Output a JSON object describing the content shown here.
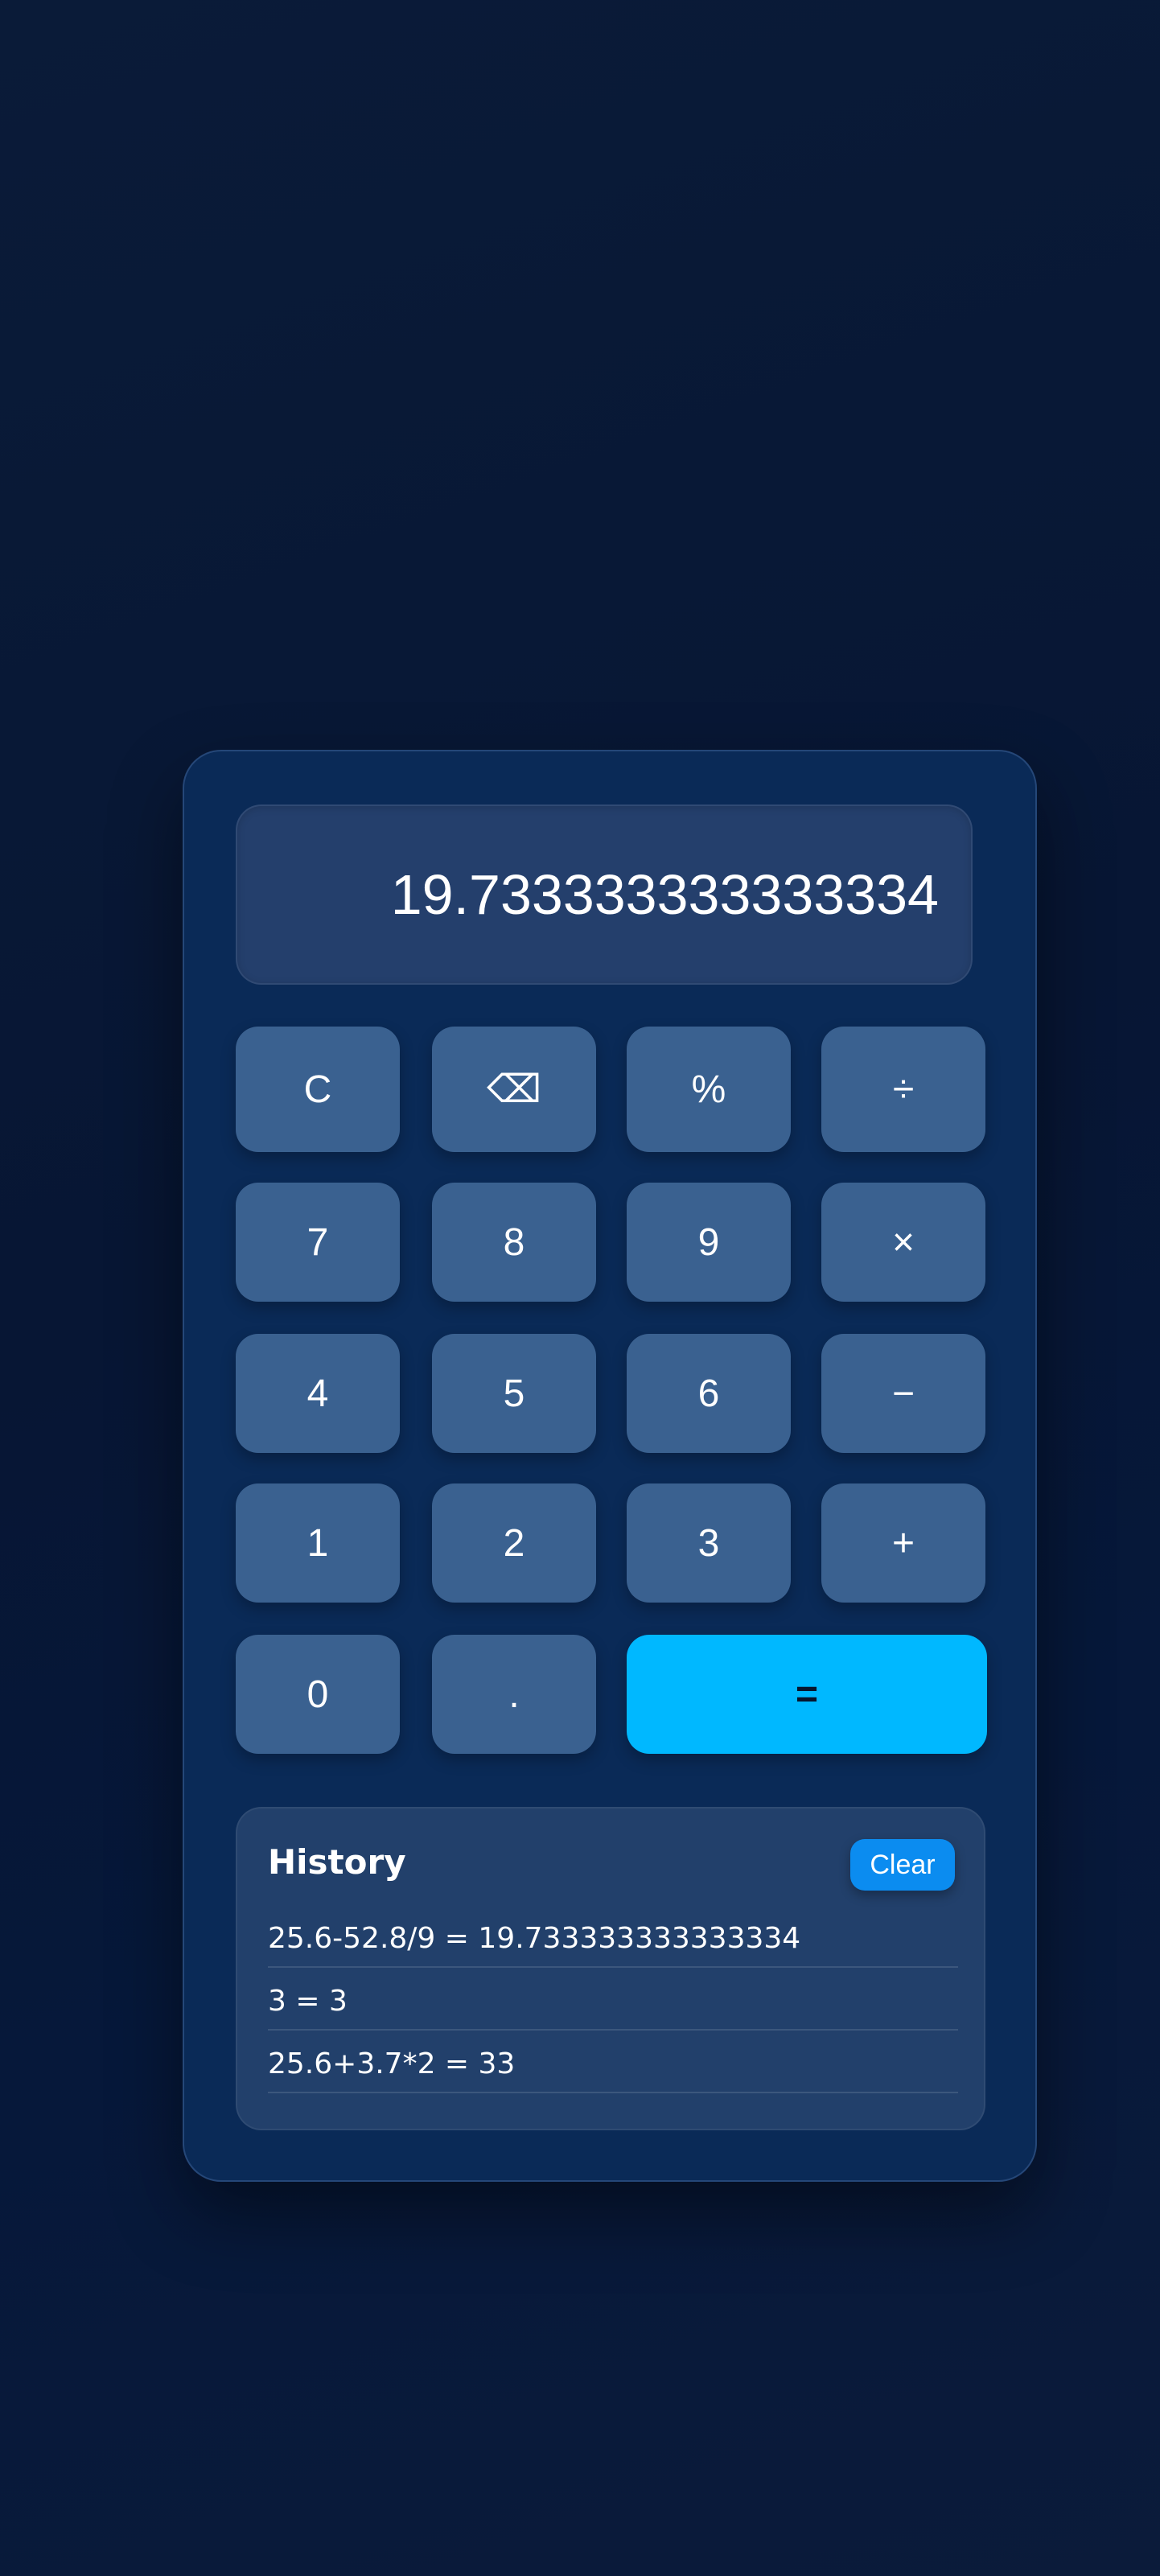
{
  "display": {
    "value": "19.733333333333334"
  },
  "keys": {
    "clear": "C",
    "backspace": "⌫",
    "percent": "%",
    "divide": "÷",
    "seven": "7",
    "eight": "8",
    "nine": "9",
    "multiply": "×",
    "four": "4",
    "five": "5",
    "six": "6",
    "subtract": "−",
    "one": "1",
    "two": "2",
    "three": "3",
    "add": "+",
    "zero": "0",
    "decimal": ".",
    "equals": "="
  },
  "history": {
    "title": "History",
    "clear_label": "Clear",
    "items": [
      {
        "text": "25.6-52.8/9 = 19.733333333333334"
      },
      {
        "text": "3 = 3"
      },
      {
        "text": "25.6+3.7*2 = 33"
      }
    ]
  },
  "colors": {
    "background": "#071634",
    "card": "#0a2a57",
    "display": "#243f6c",
    "key": "#3a6190",
    "equals_key": "#00b8ff",
    "clear_button": "#0b8cf0"
  }
}
